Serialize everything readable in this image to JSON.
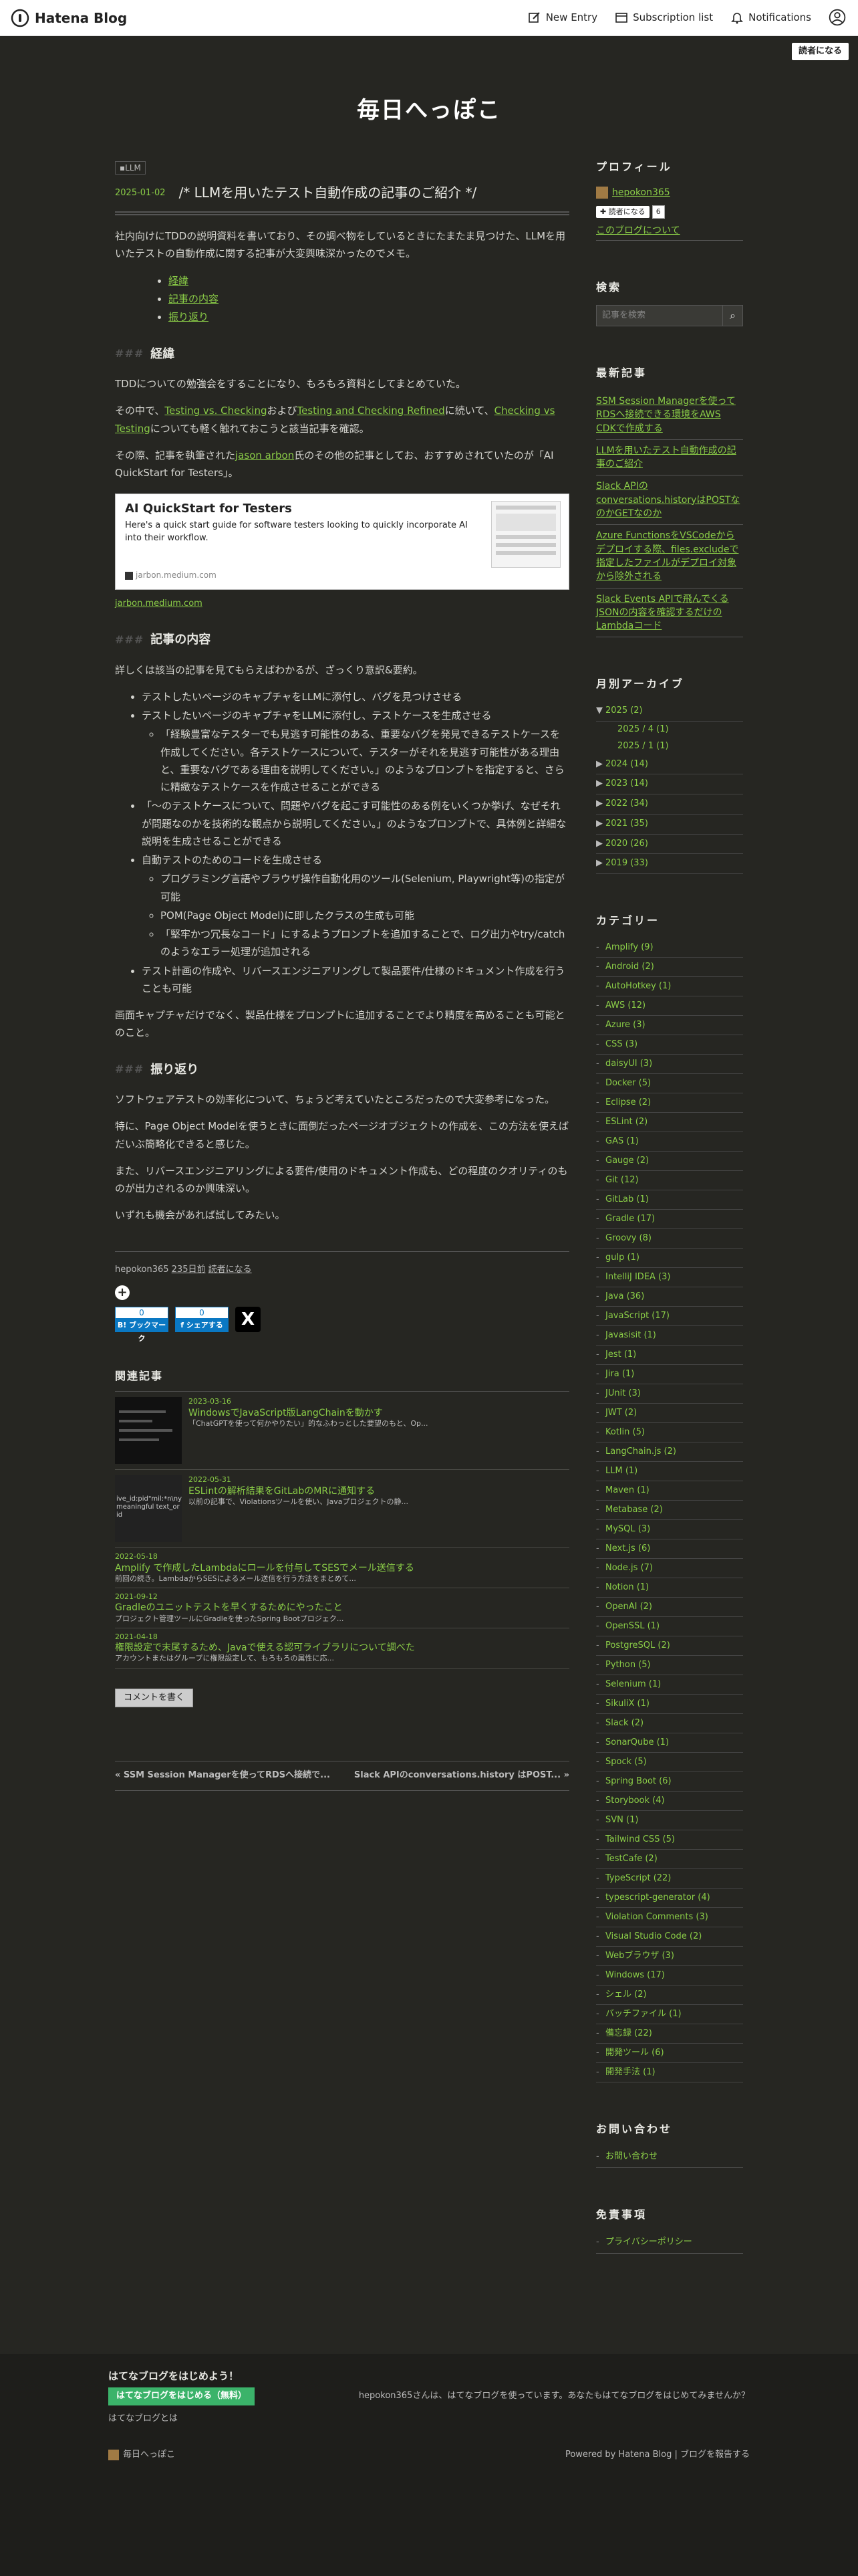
{
  "topbar": {
    "logo_text": "Hatena Blog",
    "new_entry": "New Entry",
    "subscription_list": "Subscription list",
    "notifications": "Notifications"
  },
  "reader_button": "読者になる",
  "blog": {
    "title": "毎日へっぽこ"
  },
  "article": {
    "category": "LLM",
    "date": "2025-01-02",
    "title": "/* LLMを用いたテスト自動作成の記事のご紹介 */",
    "intro": "社内向けにTDDの説明資料を書いており、その調べ物をしているときにたまたま見つけた、LLMを用いたテストの自動作成に関する記事が大変興味深かったのでメモ。",
    "toc": [
      "経緯",
      "記事の内容",
      "振り返り"
    ],
    "sections": [
      {
        "heading": "経緯",
        "mark": "###"
      },
      {
        "heading": "記事の内容",
        "mark": "###"
      },
      {
        "heading": "振り返り",
        "mark": "###"
      }
    ],
    "s1": {
      "p1": "TDDについての勉強会をすることになり、もろもろ資料としてまとめていた。",
      "p2_pre": "その中で、",
      "p2_link1": "Testing vs. Checking",
      "p2_mid1": "および",
      "p2_link2": "Testing and Checking Refined",
      "p2_mid2": "に続いて、",
      "p2_link3": "Checking vs Testing",
      "p2_post": "についても軽く触れておこうと該当記事を確認。",
      "p3_pre": "その際、記事を執筆された",
      "p3_link": "jason arbon",
      "p3_post": "氏のその他の記事としてお、おすすめされていたのが「AI QuickStart for Testers」。"
    },
    "embed": {
      "title": "AI QuickStart for Testers",
      "description": "Here's a quick start guide for software testers looking to quickly incorporate AI into their workflow.",
      "domain": "jarbon.medium.com",
      "link": "jarbon.medium.com"
    },
    "s2": {
      "p1": "詳しくは該当の記事を見てもらえばわかるが、ざっくり意訳&要約。",
      "bullets": [
        "テストしたいページのキャプチャをLLMに添付し、バグを見つけさせる",
        "テストしたいページのキャプチャをLLMに添付し、テストケースを生成させる",
        "「〜のテストケースについて、問題やバグを起こす可能性のある例をいくつか挙げ、なぜそれが問題なのかを技術的な観点から説明してください。」のようなプロンプトで、具体例と詳細な説明を生成させることができる",
        "自動テストのためのコードを生成させる",
        "テスト計画の作成や、リバースエンジニアリングして製品要件/仕様のドキュメント作成を行うことも可能"
      ],
      "sub1": [
        "「経験豊富なテスターでも見逃す可能性のある、重要なバグを発見できるテストケースを作成してください。各テストケースについて、テスターがそれを見逃す可能性がある理由と、重要なバグである理由を説明してください。」のようなプロンプトを指定すると、さらに精緻なテストケースを作成させることができる"
      ],
      "sub2": [
        "プログラミング言語やブラウザ操作自動化用のツール(Selenium, Playwright等)の指定が可能",
        "POM(Page Object Model)に即したクラスの生成も可能",
        "「堅牢かつ冗長なコード」にするようプロンプトを追加することで、ログ出力やtry/catchのようなエラー処理が追加される"
      ],
      "p2": "画面キャプチャだけでなく、製品仕様をプロンプトに追加することでより精度を高めることも可能とのこと。"
    },
    "s3": {
      "p1": "ソフトウェアテストの効率化について、ちょうど考えていたところだったので大変参考になった。",
      "p2": "特に、Page Object Modelを使うときに面倒だったページオブジェクトの作成を、この方法を使えばだいぶ簡略化できると感じた。",
      "p3": "また、リバースエンジニアリングによる要件/使用のドキュメント作成も、どの程度のクオリティのものが出力されるのか興味深い。",
      "p4": "いずれも機会があれば試してみたい。"
    },
    "footer": {
      "author": "hepokon365",
      "ago": "235日前",
      "reader": "読者になる"
    },
    "shares": {
      "hatena_count": "0",
      "hatena_label": "B! ブックマーク",
      "fb_count": "0",
      "fb_label": "f シェアする",
      "x_label": "X"
    }
  },
  "related": {
    "heading": "関連記事",
    "items": [
      {
        "date": "2023-03-16",
        "title": "WindowsでJavaScript版LangChainを動かす",
        "snippet": "「ChatGPTを使って何かやりたい」的なふわっとした要望のもと、Op..."
      },
      {
        "date": "2022-05-31",
        "title": "ESLintの解析結果をGitLabのMRに通知する",
        "snippet": "以前の記事で、Violationsツールを使い、Javaプロジェクトの静..."
      },
      {
        "date": "2022-05-18",
        "title": "Amplify で作成したLambdaにロールを付与してSESでメール送信する",
        "snippet": "前回の続き。LambdaからSESによるメール送信を行う方法をまとめて..."
      },
      {
        "date": "2021-09-12",
        "title": "Gradleのユニットテストを早くするためにやったこと",
        "snippet": "プロジェクト管理ツールにGradleを使ったSpring Bootプロジェク..."
      },
      {
        "date": "2021-04-18",
        "title": "権限設定で末尾するため、Javaで使える認可ライブラリについて調べた",
        "snippet": "アカウントまたはグループに権限設定して、もろもろの属性に応..."
      }
    ],
    "thumb2_text": "ive_id:pid\"mil:*n\\nyx.it-meaningful text_or id"
  },
  "comment_button": "コメントを書く",
  "pager": {
    "prev": "« SSM Session Managerを使ってRDSへ接続で...",
    "next": "Slack APIのconversations.history はPOST... »"
  },
  "sidebar": {
    "profile": {
      "heading": "プロフィール",
      "name": "hepokon365",
      "reader": "読者になる",
      "count": "6",
      "about": "このブログについて"
    },
    "search": {
      "heading": "検索",
      "placeholder": "記事を検索"
    },
    "recent": {
      "heading": "最新記事",
      "items": [
        "SSM Session Managerを使ってRDSへ接続できる環境をAWS CDKで作成する",
        "LLMを用いたテスト自動作成の記事のご紹介",
        "Slack APIのconversations.historyはPOSTなのかGETなのか",
        "Azure FunctionsをVSCodeからデプロイする際、files.excludeで指定したファイルがデプロイ対象から除外される",
        "Slack Events APIで飛んでくるJSONの内容を確認するだけのLambdaコード"
      ]
    },
    "archive": {
      "heading": "月別アーカイブ",
      "open": {
        "label": "2025 (2)",
        "months": [
          "2025 / 4 (1)",
          "2025 / 1 (1)"
        ]
      },
      "years": [
        "2024 (14)",
        "2023 (14)",
        "2022 (34)",
        "2021 (35)",
        "2020 (26)",
        "2019 (33)"
      ]
    },
    "categories": {
      "heading": "カテゴリー",
      "items": [
        "Amplify (9)",
        "Android (2)",
        "AutoHotkey (1)",
        "AWS (12)",
        "Azure (3)",
        "CSS (3)",
        "daisyUI (3)",
        "Docker (5)",
        "Eclipse (2)",
        "ESLint (2)",
        "GAS (1)",
        "Gauge (2)",
        "Git (12)",
        "GitLab (1)",
        "Gradle (17)",
        "Groovy (8)",
        "gulp (1)",
        "IntelliJ IDEA (3)",
        "Java (36)",
        "JavaScript (17)",
        "Javasisit (1)",
        "Jest (1)",
        "Jira (1)",
        "JUnit (3)",
        "JWT (2)",
        "Kotlin (5)",
        "LangChain.js (2)",
        "LLM (1)",
        "Maven (1)",
        "Metabase (2)",
        "MySQL (3)",
        "Next.js (6)",
        "Node.js (7)",
        "Notion (1)",
        "OpenAI (2)",
        "OpenSSL (1)",
        "PostgreSQL (2)",
        "Python (5)",
        "Selenium (1)",
        "SikuliX (1)",
        "Slack (2)",
        "SonarQube (1)",
        "Spock (5)",
        "Spring Boot (6)",
        "Storybook (4)",
        "SVN (1)",
        "Tailwind CSS (5)",
        "TestCafe (2)",
        "TypeScript (22)",
        "typescript-generator (4)",
        "Violation Comments (3)",
        "Visual Studio Code (2)",
        "Webブラウザ (3)",
        "Windows (17)",
        "シェル (2)",
        "バッチファイル (1)",
        "備忘録 (22)",
        "開発ツール (6)",
        "開発手法 (1)"
      ]
    },
    "contact": {
      "heading": "お問い合わせ",
      "link": "お問い合わせ"
    },
    "disclaimer": {
      "heading": "免責事項",
      "link": "プライバシーポリシー"
    }
  },
  "page_footer": {
    "heading": "はてなブログをはじめよう！",
    "cta": "はてなブログをはじめる（無料）",
    "what": "はてなブログとは",
    "message": "hepokon365さんは、はてなブログを使っています。あなたもはてなブログをはじめてみませんか？",
    "blog_name": "毎日へっぽこ",
    "powered": "Powered by Hatena Blog | ブログを報告する"
  }
}
